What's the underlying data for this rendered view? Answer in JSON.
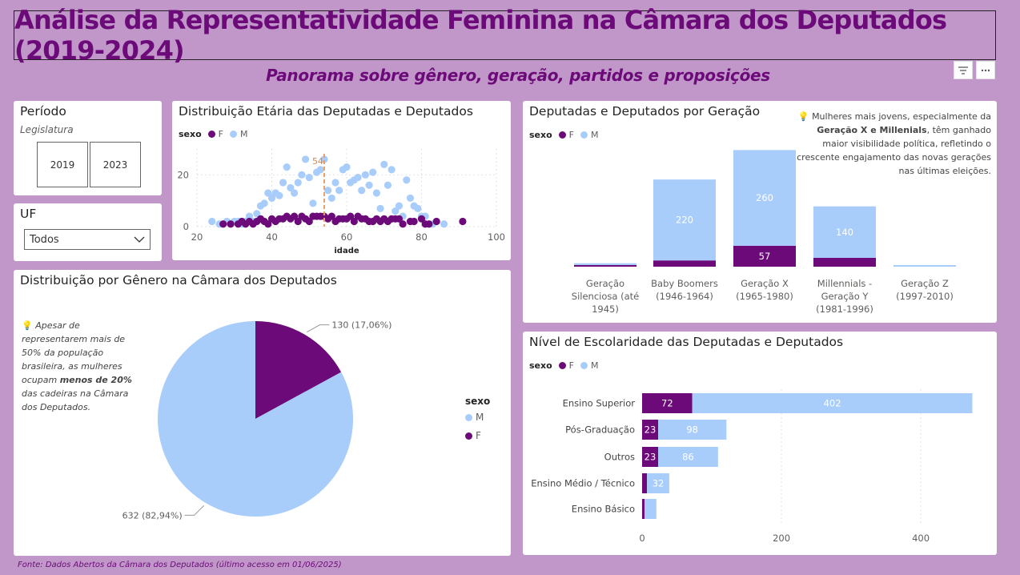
{
  "header": {
    "title": "Análise da Representatividade Feminina na Câmara dos Deputados (2019-2024)",
    "subtitle": "Panorama sobre gênero, geração, partidos e proposições"
  },
  "toolbar": {
    "filter_icon": "filter-icon",
    "more_icon": "more-options-icon"
  },
  "periodo": {
    "title": "Período",
    "label": "Legislatura",
    "options": [
      "2019",
      "2023"
    ]
  },
  "uf": {
    "title": "UF",
    "selected": "Todos"
  },
  "colors": {
    "F": "#6b0a78",
    "M": "#a8cdfb",
    "accent": "#6b0a78",
    "refline": "#e8a06a"
  },
  "legend": {
    "title": "sexo",
    "F": "F",
    "M": "M"
  },
  "age_chart": {
    "title": "Distribuição Etária das Deputadas e Deputados",
    "chart_data": {
      "type": "scatter",
      "xlabel": "idade",
      "xticks": [
        "20",
        "40",
        "60",
        "80",
        "100"
      ],
      "yticks": [
        "0",
        "20"
      ],
      "xlim": [
        20,
        100
      ],
      "ylim": [
        0,
        30
      ],
      "reference_label": "54",
      "reference_x": 54,
      "series": [
        {
          "name": "F",
          "points": [
            [
              27,
              1
            ],
            [
              29,
              1
            ],
            [
              31,
              1
            ],
            [
              32,
              2
            ],
            [
              33,
              1
            ],
            [
              34,
              2
            ],
            [
              35,
              1
            ],
            [
              36,
              2
            ],
            [
              37,
              3
            ],
            [
              38,
              2
            ],
            [
              39,
              1
            ],
            [
              40,
              3
            ],
            [
              41,
              2
            ],
            [
              42,
              3
            ],
            [
              43,
              3
            ],
            [
              44,
              4
            ],
            [
              45,
              3
            ],
            [
              46,
              4
            ],
            [
              47,
              2
            ],
            [
              48,
              4
            ],
            [
              49,
              3
            ],
            [
              50,
              2
            ],
            [
              51,
              4
            ],
            [
              52,
              4
            ],
            [
              53,
              4
            ],
            [
              54,
              4
            ],
            [
              55,
              3
            ],
            [
              56,
              4
            ],
            [
              57,
              2
            ],
            [
              58,
              3
            ],
            [
              59,
              3
            ],
            [
              60,
              3
            ],
            [
              61,
              4
            ],
            [
              62,
              2
            ],
            [
              63,
              4
            ],
            [
              64,
              3
            ],
            [
              65,
              3
            ],
            [
              66,
              2
            ],
            [
              67,
              2
            ],
            [
              68,
              3
            ],
            [
              69,
              2
            ],
            [
              70,
              3
            ],
            [
              71,
              2
            ],
            [
              72,
              3
            ],
            [
              73,
              3
            ],
            [
              74,
              3
            ],
            [
              75,
              1
            ],
            [
              77,
              2
            ],
            [
              78,
              2
            ],
            [
              80,
              3
            ],
            [
              81,
              1
            ],
            [
              82,
              1
            ],
            [
              84,
              2
            ],
            [
              91,
              2
            ]
          ]
        },
        {
          "name": "M",
          "points": [
            [
              24,
              2
            ],
            [
              26,
              1
            ],
            [
              28,
              2
            ],
            [
              30,
              2
            ],
            [
              31,
              2
            ],
            [
              32,
              1
            ],
            [
              33,
              2
            ],
            [
              34,
              4
            ],
            [
              35,
              2
            ],
            [
              36,
              5
            ],
            [
              37,
              8
            ],
            [
              38,
              9
            ],
            [
              39,
              13
            ],
            [
              40,
              11
            ],
            [
              41,
              13
            ],
            [
              42,
              12
            ],
            [
              43,
              17
            ],
            [
              44,
              23
            ],
            [
              45,
              15
            ],
            [
              46,
              13
            ],
            [
              47,
              17
            ],
            [
              48,
              20
            ],
            [
              49,
              26
            ],
            [
              50,
              19
            ],
            [
              51,
              9
            ],
            [
              52,
              21
            ],
            [
              53,
              22
            ],
            [
              54,
              26
            ],
            [
              55,
              14
            ],
            [
              56,
              11
            ],
            [
              57,
              17
            ],
            [
              58,
              14
            ],
            [
              59,
              22
            ],
            [
              60,
              23
            ],
            [
              61,
              17
            ],
            [
              62,
              18
            ],
            [
              63,
              19
            ],
            [
              64,
              14
            ],
            [
              65,
              20
            ],
            [
              66,
              16
            ],
            [
              67,
              21
            ],
            [
              68,
              13
            ],
            [
              69,
              7
            ],
            [
              70,
              24
            ],
            [
              71,
              16
            ],
            [
              72,
              22
            ],
            [
              73,
              6
            ],
            [
              74,
              8
            ],
            [
              75,
              4
            ],
            [
              76,
              18
            ],
            [
              77,
              11
            ],
            [
              78,
              8
            ],
            [
              79,
              7
            ],
            [
              80,
              4
            ],
            [
              81,
              4
            ],
            [
              83,
              1
            ],
            [
              86,
              1
            ]
          ]
        }
      ]
    }
  },
  "pie_chart": {
    "title": "Distribuição por Gênero na Câmara dos Deputados",
    "note_parts": [
      "Apesar de representarem mais de 50% da população brasileira, as mulheres ocupam ",
      "menos de 20%",
      " das cadeiras na Câmara dos Deputados."
    ],
    "legend_title": "sexo",
    "legend_items": [
      "M",
      "F"
    ],
    "chart_data": {
      "type": "pie",
      "categories": [
        "F",
        "M"
      ],
      "values": [
        130,
        632
      ],
      "labels": [
        "130 (17,06%)",
        "632 (82,94%)"
      ]
    }
  },
  "generation_chart": {
    "title": "Deputadas e Deputados por Geração",
    "note_parts": [
      "Mulheres mais jovens, especialmente da ",
      "Geração X e Millenials",
      ", têm ganhado maior visibilidade política, refletindo o crescente engajamento das novas gerações nas últimas eleições."
    ],
    "chart_data": {
      "type": "bar",
      "stacked": true,
      "categories": [
        "Geração Silenciosa (até 1945)",
        "Baby Boomers (1946-1964)",
        "Geração X (1965-1980)",
        "Millennials - Geração Y (1981-1996)",
        "Geração Z (1997-2010)"
      ],
      "category_lines": [
        [
          "Geração",
          "Silenciosa (até",
          "1945)"
        ],
        [
          "Baby Boomers",
          "(1946-1964)"
        ],
        [
          "Geração X",
          "(1965-1980)"
        ],
        [
          "Millennials -",
          "Geração Y",
          "(1981-1996)"
        ],
        [
          "Geração Z",
          "(1997-2010)"
        ]
      ],
      "series": [
        {
          "name": "F",
          "values": [
            1,
            17,
            57,
            24,
            0
          ],
          "labels": [
            "",
            "",
            "57",
            "",
            ""
          ]
        },
        {
          "name": "M",
          "values": [
            5,
            220,
            260,
            140,
            2
          ],
          "labels": [
            "",
            "220",
            "260",
            "140",
            ""
          ]
        }
      ],
      "ylim": [
        0,
        320
      ]
    }
  },
  "education_chart": {
    "title": "Nível de Escolaridade das Deputadas e Deputados",
    "chart_data": {
      "type": "bar",
      "orientation": "horizontal",
      "stacked": true,
      "categories": [
        "Ensino Superior",
        "Pós-Graduação",
        "Outros",
        "Ensino Médio / Técnico",
        "Ensino Básico"
      ],
      "series": [
        {
          "name": "F",
          "values": [
            72,
            23,
            23,
            7,
            2
          ],
          "labels": [
            "72",
            "23",
            "23",
            "",
            ""
          ]
        },
        {
          "name": "M",
          "values": [
            402,
            98,
            86,
            32,
            17
          ],
          "labels": [
            "402",
            "98",
            "86",
            "32",
            ""
          ]
        }
      ],
      "xticks": [
        "0",
        "200",
        "400"
      ],
      "xlim": [
        0,
        470
      ]
    }
  },
  "footer": "Fonte: Dados Abertos da Câmara dos Deputados (último acesso em 01/06/2025)"
}
